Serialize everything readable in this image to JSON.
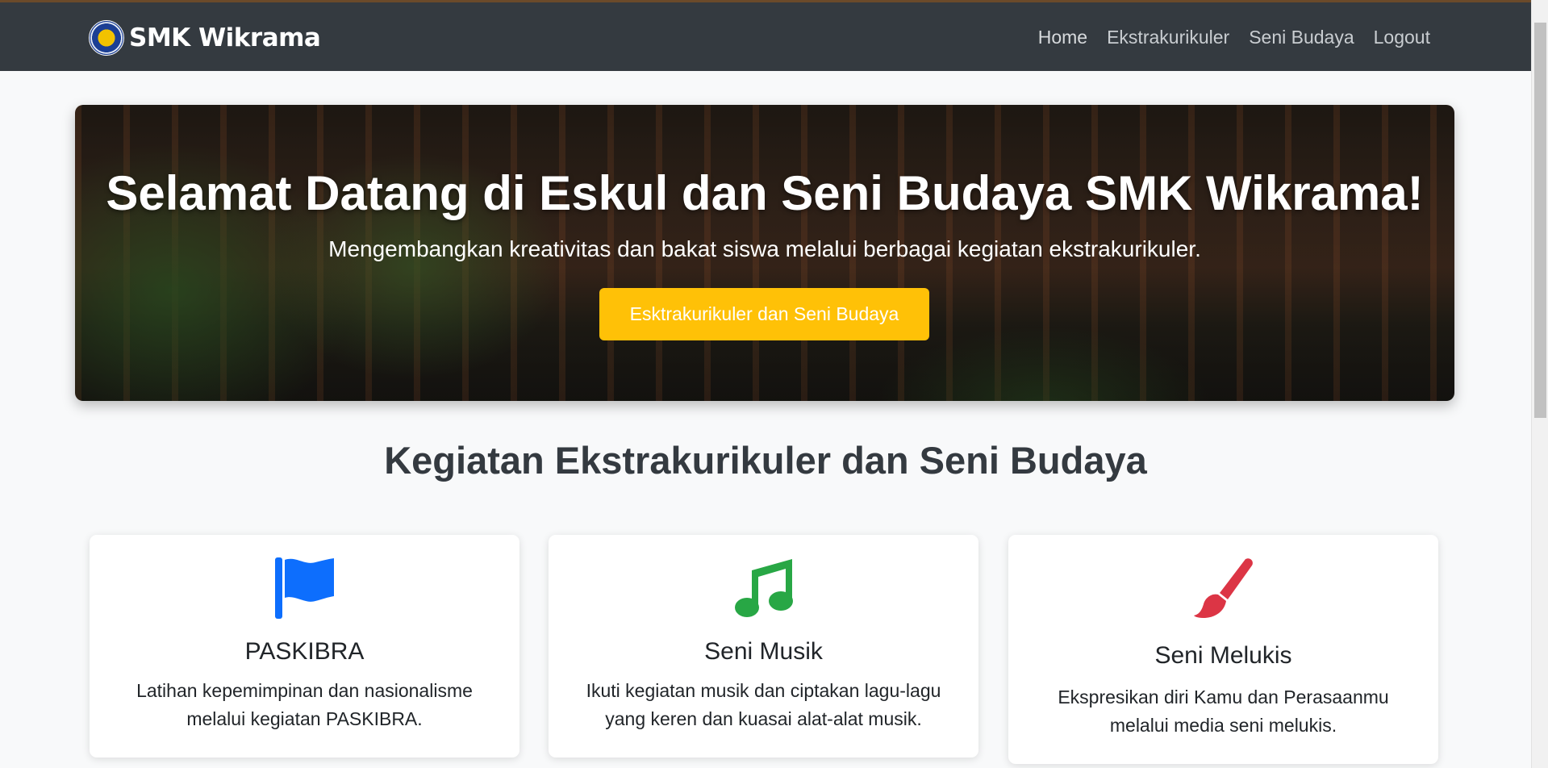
{
  "navbar": {
    "brand": "SMK Wikrama",
    "links": [
      "Home",
      "Ekstrakurikuler",
      "Seni Budaya",
      "Logout"
    ]
  },
  "hero": {
    "title": "Selamat Datang di Eskul dan Seni Budaya SMK Wikrama!",
    "subtitle": "Mengembangkan kreativitas dan bakat siswa melalui berbagai kegiatan ekstrakurikuler.",
    "button_label": "Esktrakurikuler dan Seni Budaya"
  },
  "section": {
    "title": "Kegiatan Ekstrakurikuler dan Seni Budaya"
  },
  "cards": [
    {
      "icon": "flag-icon",
      "icon_color": "#0d6efd",
      "title": "PASKIBRA",
      "text": "Latihan kepemimpinan dan nasionalisme melalui kegiatan PASKIBRA."
    },
    {
      "icon": "music-icon",
      "icon_color": "#28a745",
      "title": "Seni Musik",
      "text": "Ikuti kegiatan musik dan ciptakan lagu-lagu yang keren dan kuasai alat-alat musik."
    },
    {
      "icon": "paintbrush-icon",
      "icon_color": "#dc3545",
      "title": "Seni Melukis",
      "text": "Ekspresikan diri Kamu dan Perasaanmu melalui media seni melukis."
    }
  ],
  "colors": {
    "navbar_bg": "#343a40",
    "accent_button": "#ffc107"
  }
}
